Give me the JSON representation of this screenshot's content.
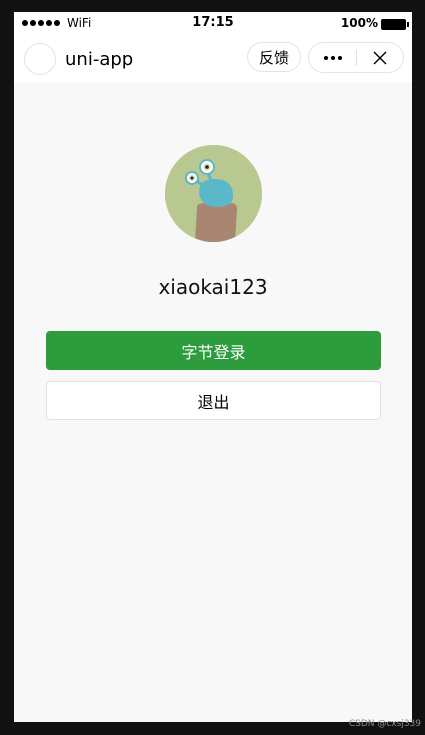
{
  "status_bar": {
    "carrier": "WiFi",
    "time": "17:15",
    "battery": "100%"
  },
  "nav": {
    "title": "uni-app",
    "feedback_label": "反馈"
  },
  "profile": {
    "username": "xiaokai123"
  },
  "actions": {
    "login_label": "字节登录",
    "logout_label": "退出"
  },
  "colors": {
    "primary_button": "#2c9c3c",
    "page_background": "#f8f8f8",
    "frame": "#111111"
  },
  "watermark": "CSDN @cxsj339"
}
